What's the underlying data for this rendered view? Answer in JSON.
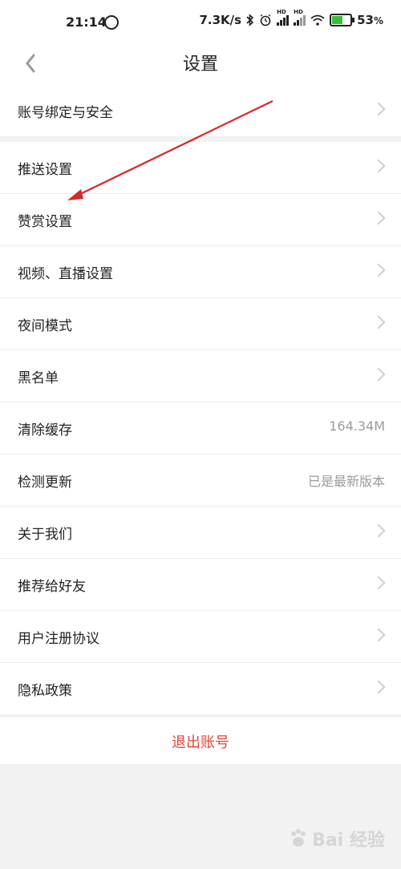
{
  "status_bar": {
    "time": "21:14",
    "net_speed": "7.3K/s",
    "battery_percent": "53",
    "battery_unit": "%",
    "battery_level": 0.53,
    "icons": [
      "app-notification-icon",
      "bluetooth-icon",
      "alarm-icon",
      "signal-hd-icon",
      "signal-hd-icon",
      "wifi-icon",
      "battery-charging-icon"
    ]
  },
  "nav": {
    "title": "设置",
    "back_icon": "chevron-left-icon"
  },
  "groups": [
    {
      "items": [
        {
          "label": "账号绑定与安全"
        }
      ]
    },
    {
      "items": [
        {
          "label": "推送设置"
        },
        {
          "label": "赞赏设置"
        },
        {
          "label": "视频、直播设置"
        },
        {
          "label": "夜间模式"
        },
        {
          "label": "黑名单"
        },
        {
          "label": "清除缓存",
          "value": "164.34M"
        },
        {
          "label": "检测更新",
          "value": "已是最新版本"
        },
        {
          "label": "关于我们"
        },
        {
          "label": "推荐给好友"
        }
      ]
    },
    {
      "items": [
        {
          "label": "用户注册协议"
        },
        {
          "label": "隐私政策"
        }
      ]
    }
  ],
  "logout": {
    "label": "退出账号"
  },
  "colors": {
    "logout": "#e0453a",
    "arrow": "#d9262b",
    "background": "#f2f2f2"
  },
  "watermark": {
    "text": "Bai 经验"
  }
}
